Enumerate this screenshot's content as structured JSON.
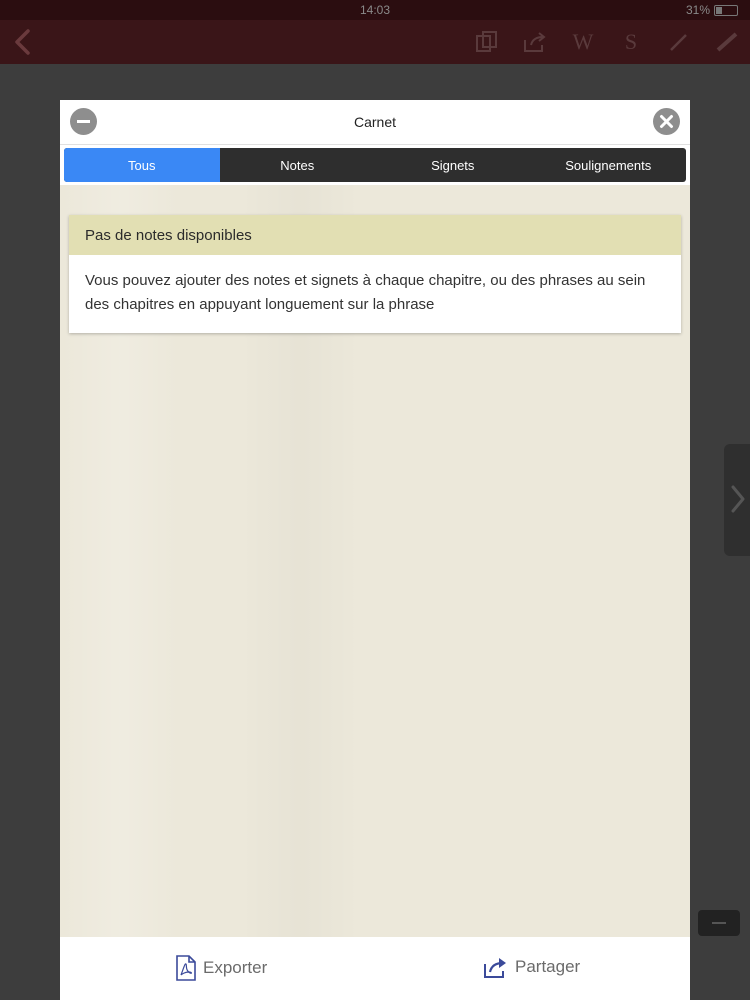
{
  "status_bar": {
    "time": "14:03",
    "battery": "31%"
  },
  "app_toolbar": {
    "tool_glyphs": [
      "W",
      "S"
    ]
  },
  "modal": {
    "title": "Carnet",
    "tabs": [
      {
        "label": "Tous",
        "active": true
      },
      {
        "label": "Notes",
        "active": false
      },
      {
        "label": "Signets",
        "active": false
      },
      {
        "label": "Soulignements",
        "active": false
      }
    ],
    "empty_state": {
      "heading": "Pas de notes disponibles",
      "message": "Vous pouvez ajouter des notes et signets à chaque chapitre, ou des phrases au sein des chapitres en appuyant longuement sur la phrase"
    },
    "footer": {
      "export_label": "Exporter",
      "share_label": "Partager"
    }
  },
  "colors": {
    "active_tab": "#3a88f5",
    "tab_bar": "#2e2e2e",
    "card_header": "#e2dfb3",
    "paper": "#ece8da",
    "toolbar": "#3a1518",
    "icon_accent": "#3b4a9a"
  },
  "icons": {
    "minus_button": "minus-circle-icon",
    "close_button": "close-circle-icon",
    "export": "pdf-document-icon",
    "share": "share-arrow-icon"
  }
}
